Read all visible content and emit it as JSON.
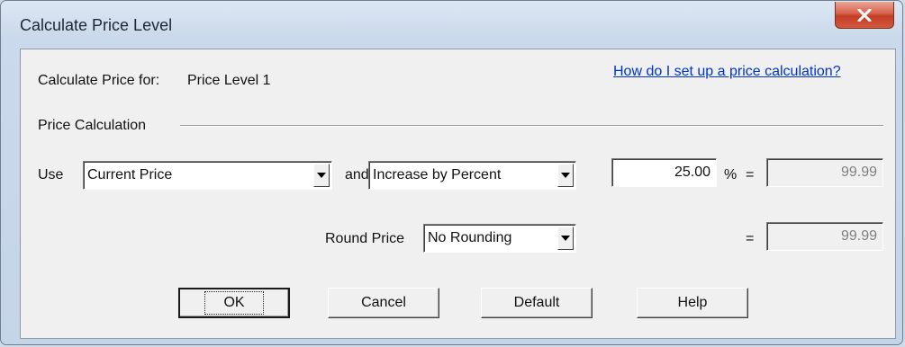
{
  "window": {
    "title": "Calculate Price Level",
    "close_symbol": "x"
  },
  "header": {
    "calc_for_label": "Calculate Price for:",
    "calc_for_value": "Price Level 1",
    "help_link": "How do I set up a price calculation?"
  },
  "group": {
    "label": "Price Calculation"
  },
  "row1": {
    "use_label": "Use",
    "base_select": "Current Price",
    "and_label": "and",
    "method_select": "Increase by Percent",
    "percent_value": "25.00",
    "percent_symbol": "%",
    "equals": "=",
    "result_value": "99.99"
  },
  "row2": {
    "round_label": "Round Price",
    "round_select": "No Rounding",
    "equals": "=",
    "result_value": "99.99"
  },
  "buttons": {
    "ok": "OK",
    "cancel": "Cancel",
    "default": "Default",
    "help": "Help"
  },
  "colors": {
    "link": "#0033cc",
    "close_button": "#c23c24",
    "disabled_text": "#808080"
  }
}
